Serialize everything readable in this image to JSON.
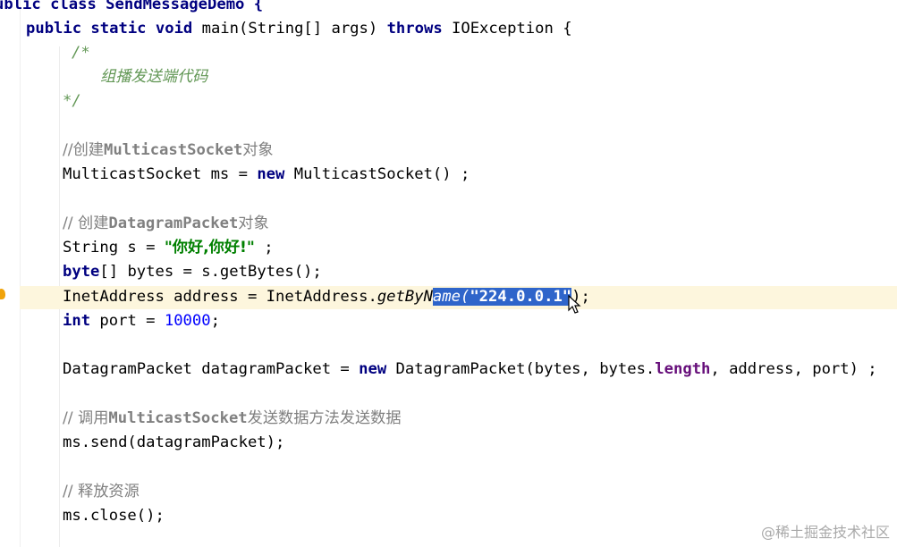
{
  "editor": {
    "lines": [
      {
        "parts": [
          {
            "t": "ublic class SendMessageDemo {",
            "c": "kw-partial"
          }
        ]
      },
      {
        "parts": [
          {
            "t": "public static void ",
            "c": "kw"
          },
          {
            "t": "main(String[] args) ",
            "c": ""
          },
          {
            "t": "throws ",
            "c": "kw"
          },
          {
            "t": "IOException {",
            "c": ""
          }
        ]
      },
      {
        "parts": [
          {
            "t": "/*",
            "c": "doc"
          }
        ]
      },
      {
        "parts": [
          {
            "t": "组播发送端代码",
            "c": "doc"
          }
        ]
      },
      {
        "parts": [
          {
            "t": "*/",
            "c": "doc"
          }
        ]
      },
      {
        "parts": []
      },
      {
        "parts": [
          {
            "t": "//创建",
            "c": "cm"
          },
          {
            "t": "MulticastSocket",
            "c": "cm-b"
          },
          {
            "t": "对象",
            "c": "cm"
          }
        ]
      },
      {
        "parts": [
          {
            "t": "MulticastSocket ms = ",
            "c": ""
          },
          {
            "t": "new ",
            "c": "kw"
          },
          {
            "t": "MulticastSocket() ;",
            "c": ""
          }
        ]
      },
      {
        "parts": []
      },
      {
        "parts": [
          {
            "t": "// 创建",
            "c": "cm"
          },
          {
            "t": "DatagramPacket",
            "c": "cm-b"
          },
          {
            "t": "对象",
            "c": "cm"
          }
        ]
      },
      {
        "parts": [
          {
            "t": "String s = ",
            "c": ""
          },
          {
            "t": "\"你好,你好!\"",
            "c": "str"
          },
          {
            "t": " ;",
            "c": ""
          }
        ]
      },
      {
        "parts": [
          {
            "t": "byte",
            "c": "kw"
          },
          {
            "t": "[] bytes = s.getBytes();",
            "c": ""
          }
        ]
      },
      {
        "parts": [
          {
            "t": "InetAddress address = InetAddress.",
            "c": ""
          },
          {
            "t": "getByN",
            "c": "mi"
          },
          {
            "t": "ame(",
            "c": "sel-mi"
          },
          {
            "t": "\"224.0.0.1\"",
            "c": "sel-str"
          },
          {
            "t": ");",
            "c": ""
          }
        ]
      },
      {
        "parts": [
          {
            "t": "int ",
            "c": "kw"
          },
          {
            "t": "port = ",
            "c": ""
          },
          {
            "t": "10000",
            "c": "num"
          },
          {
            "t": ";",
            "c": ""
          }
        ]
      },
      {
        "parts": []
      },
      {
        "parts": [
          {
            "t": "DatagramPacket datagramPacket = ",
            "c": ""
          },
          {
            "t": "new ",
            "c": "kw"
          },
          {
            "t": "DatagramPacket(bytes, bytes.",
            "c": ""
          },
          {
            "t": "length",
            "c": "field"
          },
          {
            "t": ", address, port) ;",
            "c": ""
          }
        ]
      },
      {
        "parts": []
      },
      {
        "parts": [
          {
            "t": "// 调用",
            "c": "cm"
          },
          {
            "t": "MulticastSocket",
            "c": "cm-b"
          },
          {
            "t": "发送数据方法发送数据",
            "c": "cm"
          }
        ]
      },
      {
        "parts": [
          {
            "t": "ms.send(datagramPacket);",
            "c": ""
          }
        ]
      },
      {
        "parts": []
      },
      {
        "parts": [
          {
            "t": "// 释放资源",
            "c": "cm"
          }
        ]
      },
      {
        "parts": [
          {
            "t": "ms.close();",
            "c": ""
          }
        ]
      }
    ]
  },
  "watermark": "@稀土掘金技术社区",
  "icons": {
    "intention": "bulb-icon",
    "pointer": "mouse-cursor-icon"
  },
  "colors": {
    "keyword": "#000080",
    "string": "#008000",
    "number": "#0000ff",
    "comment": "#808080",
    "doc": "#629755",
    "selection": "#2f65ca",
    "current_line": "#fdf6dd"
  }
}
